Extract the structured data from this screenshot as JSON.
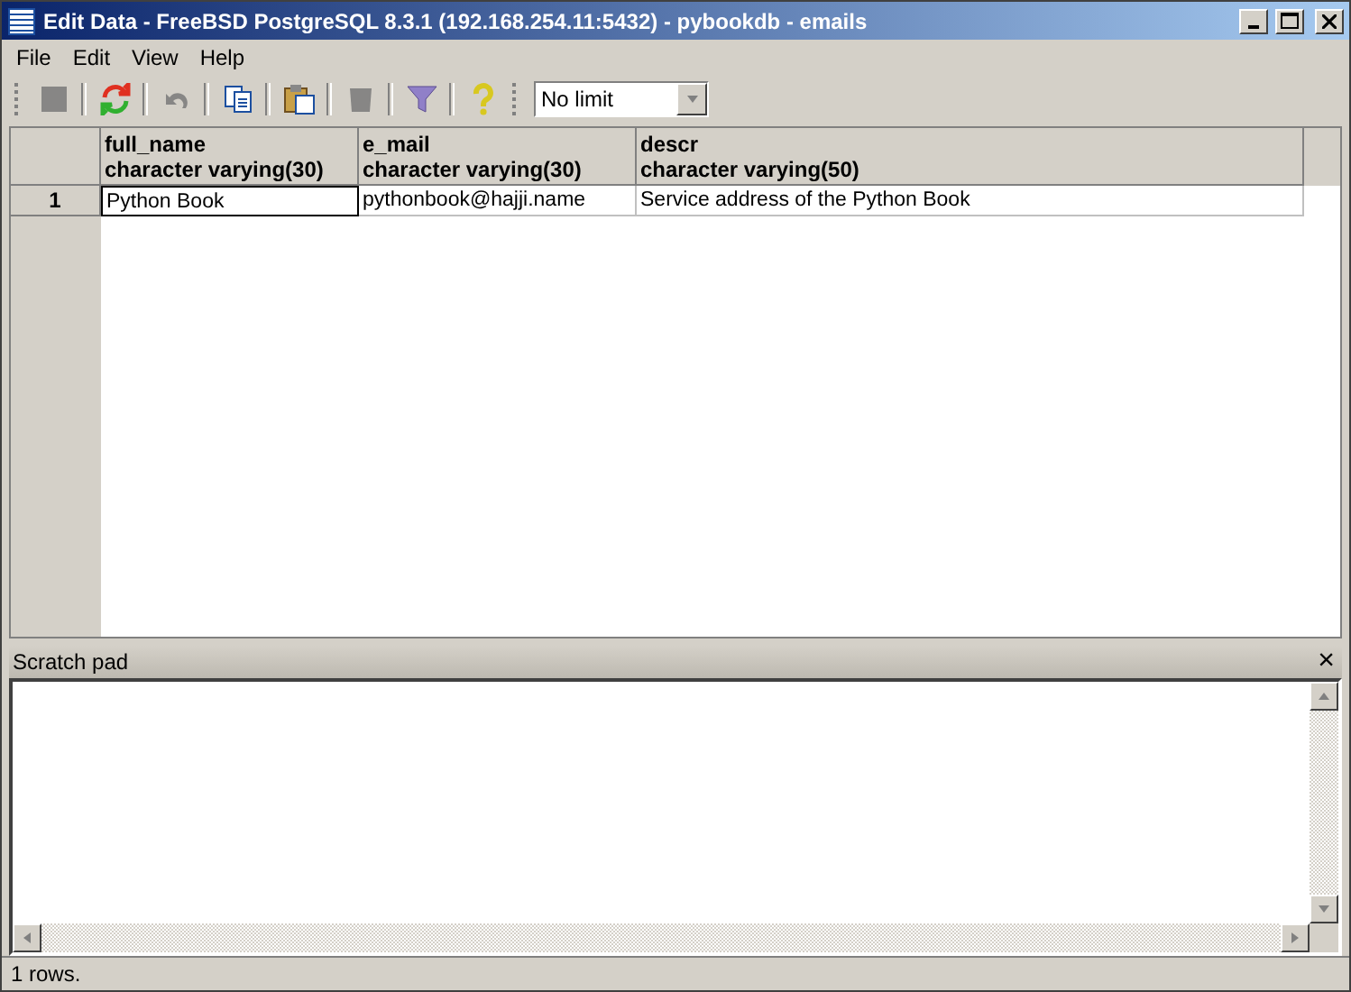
{
  "window": {
    "title": "Edit Data - FreeBSD PostgreSQL 8.3.1 (192.168.254.11:5432) - pybookdb - emails"
  },
  "menu": [
    "File",
    "Edit",
    "View",
    "Help"
  ],
  "toolbar": [
    {
      "kind": "save",
      "disabled": true
    },
    {
      "kind": "refresh",
      "disabled": false
    },
    {
      "kind": "undo",
      "disabled": true
    },
    {
      "kind": "copy",
      "disabled": false
    },
    {
      "kind": "paste",
      "disabled": false
    },
    {
      "kind": "delete",
      "disabled": true
    },
    {
      "kind": "filter",
      "disabled": false
    },
    {
      "kind": "help",
      "disabled": false
    }
  ],
  "limit": {
    "value": "No limit"
  },
  "table": {
    "columns": [
      {
        "name": "full_name",
        "type": "character varying(30)"
      },
      {
        "name": "e_mail",
        "type": "character varying(30)"
      },
      {
        "name": "descr",
        "type": "character varying(50)"
      }
    ],
    "rows": [
      {
        "number": "1",
        "cells": [
          {
            "text": "Python Book",
            "selected": true
          },
          {
            "text": "pythonbook@hajji.name",
            "selected": false
          },
          {
            "text": "Service address of the Python Book",
            "selected": false
          }
        ]
      }
    ]
  },
  "scratch_pad": {
    "title": "Scratch pad",
    "close": "×"
  },
  "status_bar": "1 rows."
}
